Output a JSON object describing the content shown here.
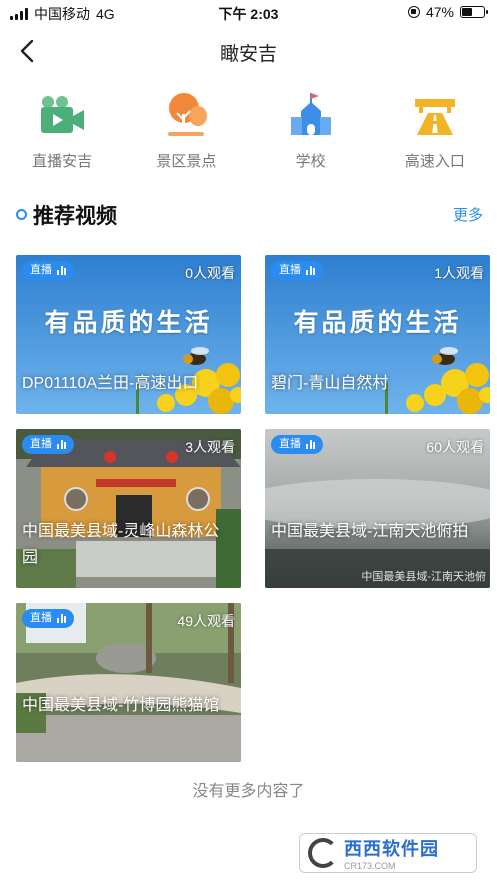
{
  "status_bar": {
    "carrier": "中国移动",
    "network": "4G",
    "time": "下午 2:03",
    "battery": "47%",
    "battery_level": 0.47
  },
  "nav": {
    "title": "瞰安吉",
    "back_icon": "chevron-left-icon"
  },
  "categories": [
    {
      "label": "直播安吉",
      "icon": "video-camera-icon",
      "color": "#4caf7a"
    },
    {
      "label": "景区景点",
      "icon": "trees-icon",
      "color": "#f08a3a"
    },
    {
      "label": "学校",
      "icon": "school-icon",
      "color": "#3d8ee8"
    },
    {
      "label": "高速入口",
      "icon": "highway-icon",
      "color": "#f2b425"
    }
  ],
  "section": {
    "title": "推荐视频",
    "more": "更多",
    "accent": "#2a8cf0"
  },
  "videos": [
    {
      "badge": "直播",
      "viewers": "0人观看",
      "title": "DP01110A兰田-高速出口",
      "banner": "有品质的生活"
    },
    {
      "badge": "直播",
      "viewers": "1人观看",
      "title": "碧门-青山自然村",
      "banner": "有品质的生活"
    },
    {
      "badge": "直播",
      "viewers": "3人观看",
      "title": "中国最美县域-灵峰山森林公园"
    },
    {
      "badge": "直播",
      "viewers": "60人观看",
      "title": "中国最美县域-江南天池俯拍",
      "watermark": "中国最美县域-江南天池俯"
    },
    {
      "badge": "直播",
      "viewers": "49人观看",
      "title": "中国最美县域-竹博园熊猫馆"
    }
  ],
  "footer": {
    "no_more": "没有更多内容了",
    "logo_main": "西西软件园",
    "logo_sub": "CR173.COM"
  }
}
